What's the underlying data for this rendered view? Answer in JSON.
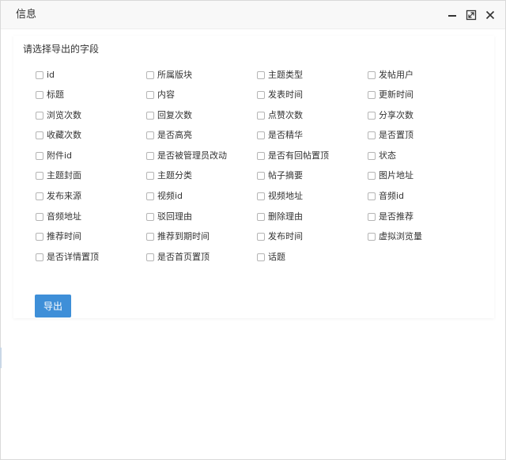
{
  "dialog": {
    "title": "信息",
    "controls": [
      {
        "icon": "minimize-icon"
      },
      {
        "icon": "maximize-icon"
      },
      {
        "icon": "close-icon"
      }
    ]
  },
  "panel": {
    "heading": "请选择导出的字段",
    "fields": [
      "id",
      "所属版块",
      "主题类型",
      "发帖用户",
      "标题",
      "内容",
      "发表时间",
      "更新时间",
      "浏览次数",
      "回复次数",
      "点赞次数",
      "分享次数",
      "收藏次数",
      "是否高亮",
      "是否精华",
      "是否置顶",
      "附件id",
      "是否被管理员改动",
      "是否有回帖置顶",
      "状态",
      "主题封面",
      "主题分类",
      "帖子摘要",
      "图片地址",
      "发布来源",
      "视频id",
      "视频地址",
      "音频id",
      "音频地址",
      "驳回理由",
      "删除理由",
      "是否推荐",
      "推荐时间",
      "推荐到期时间",
      "发布时间",
      "虚拟浏览量",
      "是否详情置顶",
      "是否首页置顶",
      "话题"
    ],
    "export_label": "导出"
  },
  "colors": {
    "primary_button": "#3e8fd8",
    "header_bg": "#f8f8f8"
  }
}
